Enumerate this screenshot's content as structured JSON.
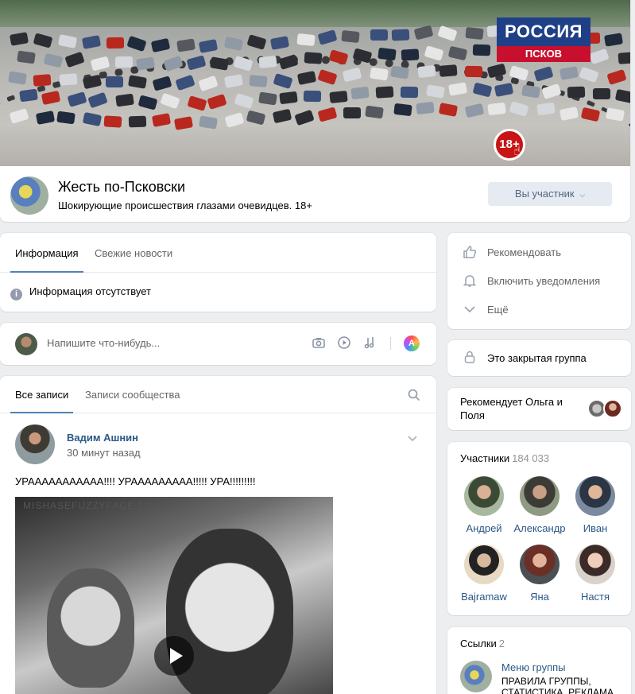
{
  "cover": {
    "logo_top": "РОССИЯ",
    "logo_bottom": "ПСКОВ",
    "age_badge": "18+"
  },
  "group": {
    "name": "Жесть по-Псковски",
    "status": "Шокирующие происшествия глазами очевидцев. 18+",
    "member_button": "Вы участник"
  },
  "info": {
    "tabs": [
      "Информация",
      "Свежие новости"
    ],
    "active_tab": 0,
    "empty_text": "Информация отсутствует"
  },
  "composer": {
    "placeholder": "Напишите что-нибудь...",
    "icons": [
      "camera-icon",
      "video-icon",
      "music-icon",
      "avatar-editor-icon"
    ]
  },
  "feed": {
    "tabs": [
      "Все записи",
      "Записи сообщества"
    ],
    "active_tab": 0
  },
  "post": {
    "author": "Вадим Ашнин",
    "time": "30 минут назад",
    "text": "УРААААААААААА!!!! УРААААААААА!!!!! УРА!!!!!!!!!",
    "video_watermark": "MISHASEFUZZYFACE TUMBLR"
  },
  "actions": {
    "items": [
      {
        "label": "Рекомендовать",
        "icon": "thumbs-up-icon"
      },
      {
        "label": "Включить уведомления",
        "icon": "bell-icon"
      },
      {
        "label": "Ещё",
        "icon": "chevron-down-icon"
      }
    ]
  },
  "closed_group": {
    "label": "Это закрытая группа",
    "icon": "lock-icon"
  },
  "recommend": {
    "text": "Рекомендует Ольга и Поля"
  },
  "members": {
    "title": "Участники",
    "count": "184 033",
    "list": [
      {
        "name": "Андрей"
      },
      {
        "name": "Александр"
      },
      {
        "name": "Иван"
      },
      {
        "name": "Bajramaw"
      },
      {
        "name": "Яна"
      },
      {
        "name": "Настя"
      }
    ]
  },
  "links": {
    "title": "Ссылки",
    "count": "2",
    "item_title": "Меню группы",
    "item_desc": "ПРАВИЛА ГРУППЫ, СТАТИСТИКА, РЕКЛАМА"
  },
  "colors": {
    "link": "#2a5885",
    "accent": "#5181b8",
    "background": "#edeef0"
  }
}
